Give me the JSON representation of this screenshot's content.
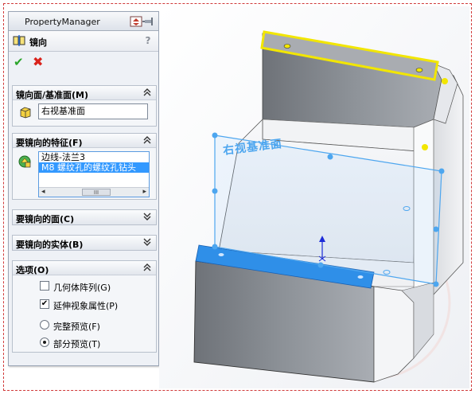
{
  "panel": {
    "title": "PropertyManager",
    "command": {
      "title": "镜向",
      "help": "?"
    },
    "groups": {
      "mirror_face": {
        "title": "镜向面/基准面(M)",
        "value": "右视基准面"
      },
      "features": {
        "title": "要镜向的特征(F)",
        "items": [
          "边线-法兰3",
          "M8 螺纹孔的螺纹孔钻头"
        ],
        "scroll_thumb": "III"
      },
      "faces": {
        "title": "要镜向的面(C)"
      },
      "bodies": {
        "title": "要镜向的实体(B)"
      },
      "options": {
        "title": "选项(O)",
        "geometry_pattern": {
          "label": "几何体阵列(G)",
          "checked": false
        },
        "propagate_visual": {
          "label": "延伸视象属性(P)",
          "checked": true
        },
        "full_preview": {
          "label": "完整预览(F)",
          "selected": false
        },
        "partial_preview": {
          "label": "部分预览(T)",
          "selected": true
        }
      }
    }
  },
  "viewport": {
    "plane_label": "右视基准面",
    "colors": {
      "selection_yellow": "#f2e600",
      "preview_blue": "#2f8fe8",
      "plane_blue": "#4da6ef"
    }
  }
}
